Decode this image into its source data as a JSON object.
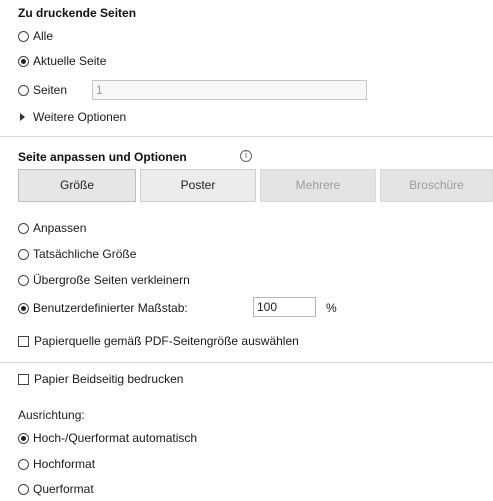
{
  "pages_section": {
    "heading": "Zu druckende Seiten",
    "options": [
      {
        "label": "Alle",
        "checked": false
      },
      {
        "label": "Aktuelle Seite",
        "checked": true
      },
      {
        "label": "Seiten",
        "checked": false
      }
    ],
    "pages_input_value": "1",
    "more_options_label": "Weitere Optionen"
  },
  "sizing_section": {
    "heading": "Seite anpassen und Optionen",
    "info_icon": "info-icon",
    "modes": [
      {
        "label": "Größe",
        "state": "selected"
      },
      {
        "label": "Poster",
        "state": "normal"
      },
      {
        "label": "Mehrere",
        "state": "disabled"
      },
      {
        "label": "Broschüre",
        "state": "disabled"
      }
    ],
    "scale_options": [
      {
        "label": "Anpassen",
        "checked": false
      },
      {
        "label": "Tatsächliche Größe",
        "checked": false
      },
      {
        "label": "Übergroße Seiten verkleinern",
        "checked": false
      },
      {
        "label": "Benutzerdefinierter Maßstab:",
        "checked": true
      }
    ],
    "custom_scale_value": "100",
    "percent_sign": "%",
    "paper_source_label": "Papierquelle gemäß PDF-Seitengröße auswählen"
  },
  "duplex": {
    "label": "Papier Beidseitig bedrucken",
    "checked": false
  },
  "orientation": {
    "heading": "Ausrichtung:",
    "options": [
      {
        "label": "Hoch-/Querformat automatisch",
        "checked": true
      },
      {
        "label": "Hochformat",
        "checked": false
      },
      {
        "label": "Querformat",
        "checked": false
      }
    ]
  }
}
